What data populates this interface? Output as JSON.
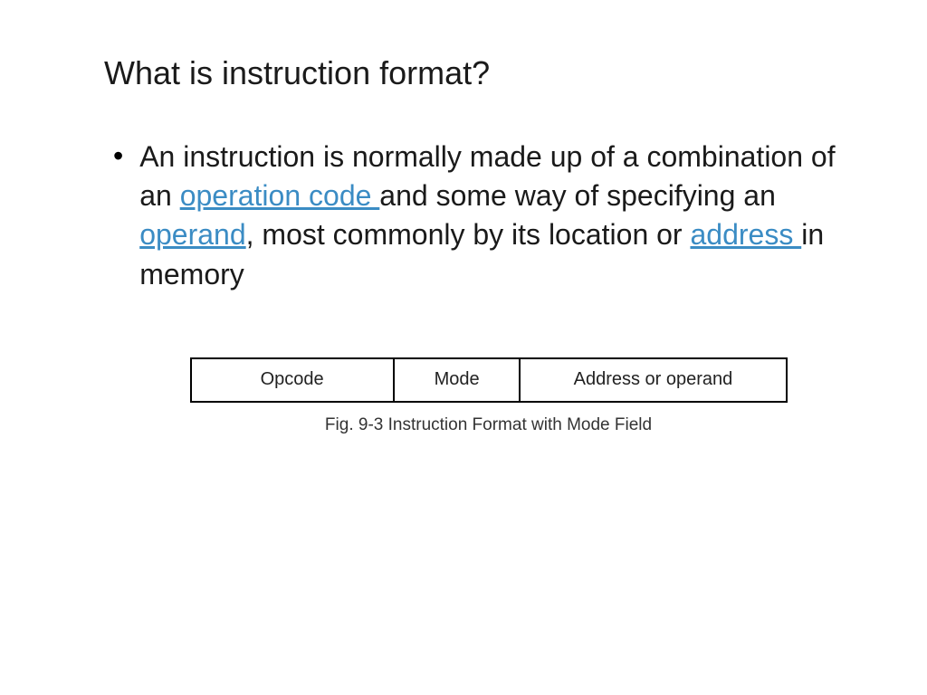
{
  "title": "What is instruction format?",
  "bullet": "•",
  "body": {
    "part1": "An instruction is normally made up of a combination of an ",
    "link1": "operation code ",
    "part2": "and some way of specifying an ",
    "link2": "operand",
    "part3": ", most commonly by its location or ",
    "link3": "address ",
    "part4": "in memory"
  },
  "figure": {
    "cells": {
      "opcode": "Opcode",
      "mode": "Mode",
      "address": "Address or operand"
    },
    "caption": "Fig. 9-3  Instruction Format with Mode Field"
  }
}
